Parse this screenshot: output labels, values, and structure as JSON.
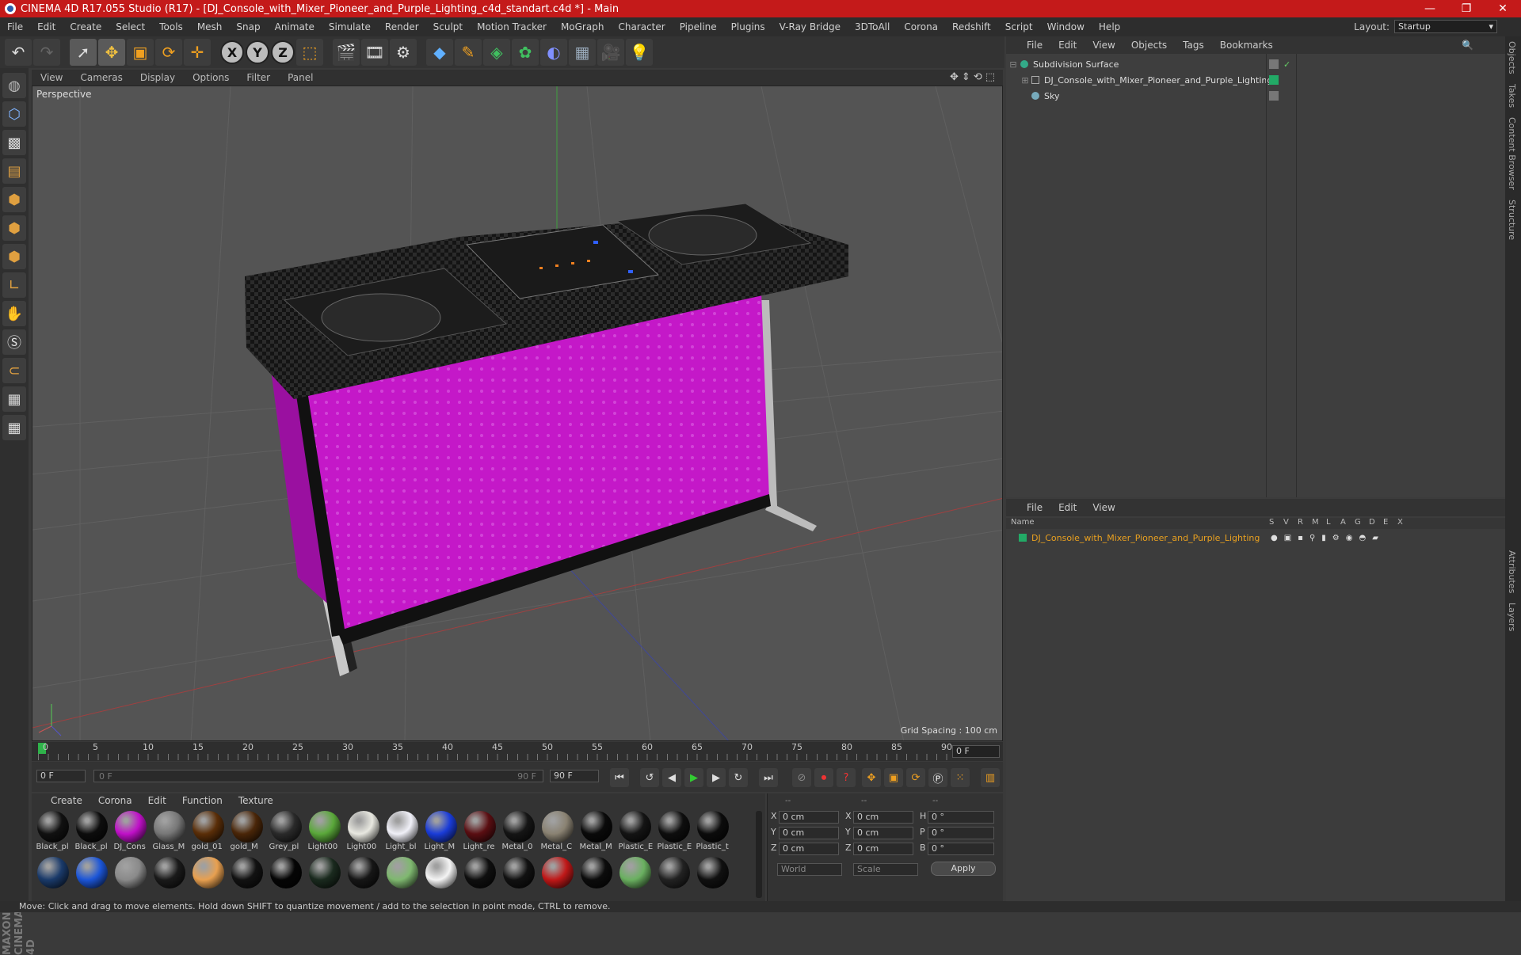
{
  "titlebar": {
    "title": "CINEMA 4D R17.055 Studio (R17) - [DJ_Console_with_Mixer_Pioneer_and_Purple_Lighting_c4d_standart.c4d *] - Main",
    "controls": [
      "—",
      "❐",
      "✕"
    ]
  },
  "menubar": {
    "items": [
      "File",
      "Edit",
      "Create",
      "Select",
      "Tools",
      "Mesh",
      "Snap",
      "Animate",
      "Simulate",
      "Render",
      "Sculpt",
      "Motion Tracker",
      "MoGraph",
      "Character",
      "Pipeline",
      "Plugins",
      "V-Ray Bridge",
      "3DToAll",
      "Corona",
      "Redshift",
      "Script",
      "Window",
      "Help"
    ],
    "layout_label": "Layout:",
    "layout_value": "Startup"
  },
  "viewport": {
    "menu": [
      "View",
      "Cameras",
      "Display",
      "Options",
      "Filter",
      "Panel"
    ],
    "camera": "Perspective",
    "grid_spacing": "Grid Spacing : 100 cm"
  },
  "timeline": {
    "ticks": [
      "0",
      "5",
      "10",
      "15",
      "20",
      "25",
      "30",
      "35",
      "40",
      "45",
      "50",
      "55",
      "60",
      "65",
      "70",
      "75",
      "80",
      "85",
      "90"
    ],
    "current_frame": "0 F"
  },
  "transport": {
    "start": "0 F",
    "range_start": "0 F",
    "range_end": "90 F",
    "end": "90 F"
  },
  "materials": {
    "menu": [
      "Create",
      "Corona",
      "Edit",
      "Function",
      "Texture"
    ],
    "row1": [
      {
        "label": "Black_pl",
        "color": "#111111"
      },
      {
        "label": "Black_pl",
        "color": "#0d0d0d"
      },
      {
        "label": "DJ_Cons",
        "color": "#c010c8"
      },
      {
        "label": "Glass_M",
        "color": "#777777"
      },
      {
        "label": "gold_01",
        "color": "#5a2e08"
      },
      {
        "label": "gold_M",
        "color": "#4a2608"
      },
      {
        "label": "Grey_pl",
        "color": "#2a2a2a"
      },
      {
        "label": "Light00",
        "color": "#5aa83a"
      },
      {
        "label": "Light00",
        "color": "#e8e8e0"
      },
      {
        "label": "Light_bl",
        "color": "#f0f0f8"
      },
      {
        "label": "Light_M",
        "color": "#1a3cd8"
      },
      {
        "label": "Light_re",
        "color": "#5a0e12"
      },
      {
        "label": "Metal_0",
        "color": "#151515"
      },
      {
        "label": "Metal_C",
        "color": "#8a8272"
      },
      {
        "label": "Metal_M",
        "color": "#0a0a0a"
      },
      {
        "label": "Plastic_E",
        "color": "#141414"
      },
      {
        "label": "Plastic_E",
        "color": "#0e0e0e"
      },
      {
        "label": "Plastic_t",
        "color": "#0c0c0c"
      }
    ],
    "row2": [
      {
        "label": "",
        "color": "#1a3a6a"
      },
      {
        "label": "",
        "color": "#1c56d8"
      },
      {
        "label": "",
        "color": "#8a8a8a"
      },
      {
        "label": "",
        "color": "#1a1a1a"
      },
      {
        "label": "",
        "color": "#e8a050"
      },
      {
        "label": "",
        "color": "#121212"
      },
      {
        "label": "",
        "color": "#050505"
      },
      {
        "label": "",
        "color": "#1a2a1e"
      },
      {
        "label": "",
        "color": "#161616"
      },
      {
        "label": "",
        "color": "#7fb870"
      },
      {
        "label": "",
        "color": "#f4f4f4"
      },
      {
        "label": "",
        "color": "#0f0f0f"
      },
      {
        "label": "",
        "color": "#111111"
      },
      {
        "label": "",
        "color": "#c01818"
      },
      {
        "label": "",
        "color": "#0c0c0c"
      },
      {
        "label": "",
        "color": "#6ab060"
      },
      {
        "label": "",
        "color": "#222222"
      },
      {
        "label": "",
        "color": "#101010"
      }
    ]
  },
  "coords": {
    "header": [
      "--",
      "--",
      "--"
    ],
    "rows": [
      {
        "a": "X",
        "av": "0 cm",
        "b": "X",
        "bv": "0 cm",
        "c": "H",
        "cv": "0 °"
      },
      {
        "a": "Y",
        "av": "0 cm",
        "b": "Y",
        "bv": "0 cm",
        "c": "P",
        "cv": "0 °"
      },
      {
        "a": "Z",
        "av": "0 cm",
        "b": "Z",
        "bv": "0 cm",
        "c": "B",
        "cv": "0 °"
      }
    ],
    "world": "World",
    "scale": "Scale",
    "apply": "Apply"
  },
  "objects": {
    "menu": [
      "File",
      "Edit",
      "View",
      "Objects",
      "Tags",
      "Bookmarks"
    ],
    "items": [
      {
        "name": "Subdivision Surface",
        "color": "#dddddd"
      },
      {
        "name": "DJ_Console_with_Mixer_Pioneer_and_Purple_Lighting",
        "color": "#dddddd"
      },
      {
        "name": "Sky",
        "color": "#dddddd"
      }
    ]
  },
  "layers": {
    "menu": [
      "File",
      "Edit",
      "View"
    ],
    "columns": [
      "Name",
      "S",
      "V",
      "R",
      "M",
      "L",
      "A",
      "G",
      "D",
      "E",
      "X"
    ],
    "rows": [
      {
        "name": "DJ_Console_with_Mixer_Pioneer_and_Purple_Lighting",
        "color": "#e8a020"
      }
    ]
  },
  "sidetabs": [
    "Objects",
    "Takes",
    "Content Browser",
    "Structure",
    "Attributes",
    "Layers"
  ],
  "brand": "MAXON CINEMA 4D",
  "status": "Move: Click and drag to move elements. Hold down SHIFT to quantize movement / add to the selection in point mode, CTRL to remove."
}
